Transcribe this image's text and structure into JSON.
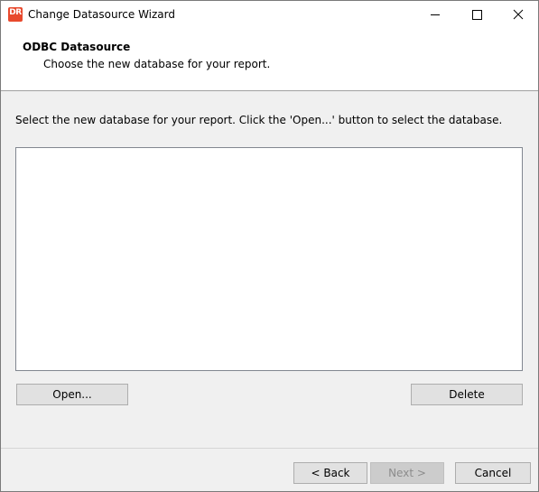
{
  "window": {
    "title": "Change Datasource Wizard",
    "icon": "dr-app-icon",
    "icon_text": "DR",
    "controls": {
      "minimize": "minimize-icon",
      "maximize": "maximize-icon",
      "close": "close-icon"
    }
  },
  "header": {
    "title": "ODBC Datasource",
    "subtitle": "Choose the new database for your report."
  },
  "body": {
    "instruction": "Select the new database for your report. Click the 'Open...' button to select the database.",
    "database_list": [],
    "open_label": "Open...",
    "delete_label": "Delete"
  },
  "footer": {
    "back_label": "< Back",
    "next_label": "Next >",
    "next_enabled": false,
    "cancel_label": "Cancel"
  },
  "colors": {
    "app_icon": "#e8492d",
    "dialog_bg": "#f0f0f0",
    "button_bg": "#e1e1e1",
    "disabled_text": "#8c8c8c"
  }
}
